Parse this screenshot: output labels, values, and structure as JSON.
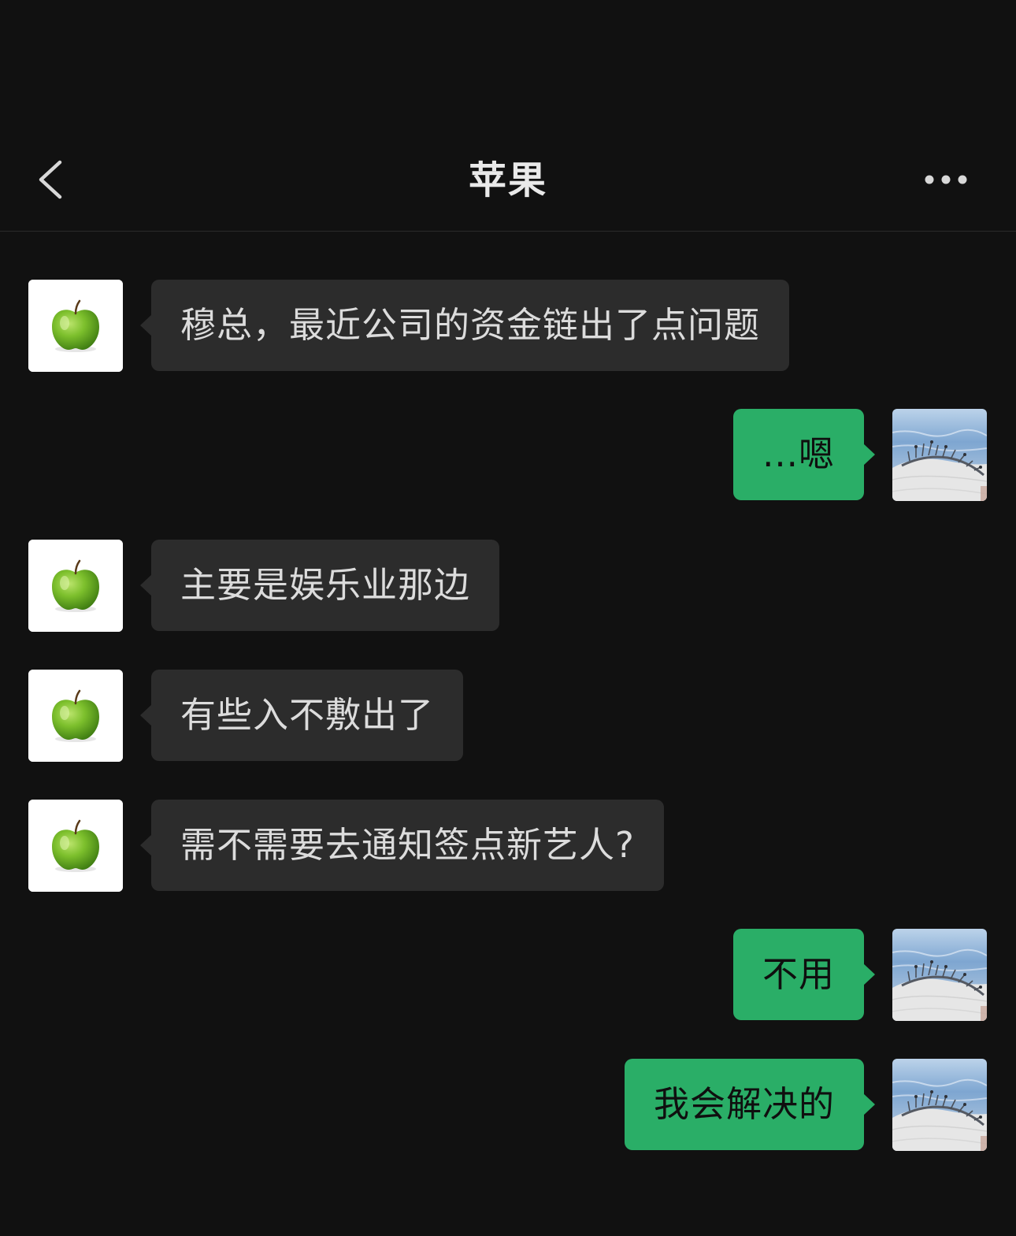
{
  "header": {
    "title": "苹果",
    "back_icon": "chevron-left-icon",
    "more_icon": "more-dots-icon"
  },
  "colors": {
    "background": "#111111",
    "incoming_bubble": "#2c2c2c",
    "outgoing_bubble": "#2aae67"
  },
  "messages": [
    {
      "sender": "contact",
      "avatar": "green-apple",
      "text": "穆总，最近公司的资金链出了点问题"
    },
    {
      "sender": "me",
      "avatar": "tiara-on-fabric",
      "text": "...嗯"
    },
    {
      "sender": "contact",
      "avatar": "green-apple",
      "text": "主要是娱乐业那边"
    },
    {
      "sender": "contact",
      "avatar": "green-apple",
      "text": "有些入不敷出了"
    },
    {
      "sender": "contact",
      "avatar": "green-apple",
      "text": "需不需要去通知签点新艺人?"
    },
    {
      "sender": "me",
      "avatar": "tiara-on-fabric",
      "text": "不用"
    },
    {
      "sender": "me",
      "avatar": "tiara-on-fabric",
      "text": "我会解决的"
    }
  ]
}
